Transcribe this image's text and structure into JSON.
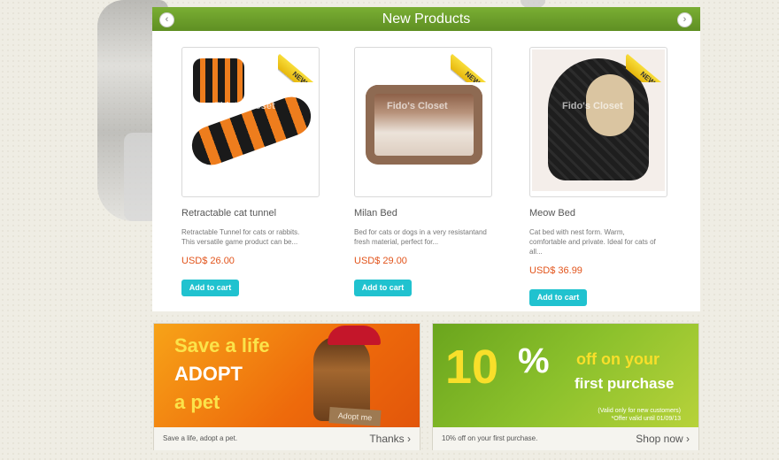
{
  "section": {
    "title": "New Products",
    "prev_icon": "‹",
    "next_icon": "›"
  },
  "ribbon_label": "NEW",
  "watermark": "Fido's Closet",
  "products": [
    {
      "name": "Retractable cat tunnel",
      "desc": "Retractable Tunnel for cats or rabbits. This versatile game product can be...",
      "price": "USD$ 26.00",
      "cta": "Add to cart"
    },
    {
      "name": "Milan Bed",
      "desc": "Bed for cats or dogs in a very resistantand fresh material, perfect for...",
      "price": "USD$ 29.00",
      "cta": "Add to cart"
    },
    {
      "name": "Meow Bed",
      "desc": "Cat bed with nest form. Warm, comfortable and private. Ideal for cats of all...",
      "price": "USD$ 36.99",
      "cta": "Add to cart"
    }
  ],
  "banners": [
    {
      "line1": "Save a life",
      "line2": "ADOPT",
      "line3": "a pet",
      "sign": "Adopt me",
      "caption": "Save a life, adopt a pet.",
      "link": "Thanks ›"
    },
    {
      "big": "10",
      "pct": "%",
      "line1": "off on your",
      "line2": "first purchase",
      "note1": "(Valid only for new customers)",
      "note2": "*Offer valid until 01/09/13",
      "caption": "10% off on your first purchase.",
      "link": "Shop now ›"
    }
  ]
}
